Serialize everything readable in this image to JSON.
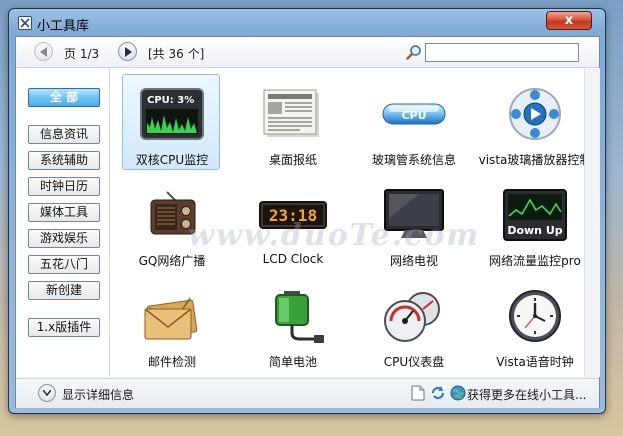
{
  "window": {
    "title": "小工具库",
    "close_label": "x"
  },
  "toolbar": {
    "page_label": "页 1/3",
    "total_label": "[共 36 个]",
    "search_value": ""
  },
  "sidebar": {
    "all_label": "全  部",
    "items": [
      {
        "label": "信息资讯"
      },
      {
        "label": "系统辅助"
      },
      {
        "label": "时钟日历"
      },
      {
        "label": "媒体工具"
      },
      {
        "label": "游戏娱乐"
      },
      {
        "label": "五花八门"
      },
      {
        "label": "新创建"
      }
    ],
    "legacy_label": "1.x版插件"
  },
  "gadgets": [
    {
      "name": "双核CPU监控",
      "icon": "cpu-meter-icon",
      "cpu_text": "CPU: 3%"
    },
    {
      "name": "桌面报纸",
      "icon": "newspaper-icon"
    },
    {
      "name": "玻璃管系统信息",
      "icon": "glass-tube-icon",
      "badge": "CPU"
    },
    {
      "name": "vista玻璃播放器控制",
      "icon": "media-player-icon"
    },
    {
      "name": "GQ网络广播",
      "icon": "radio-icon"
    },
    {
      "name": "LCD Clock",
      "icon": "lcd-clock-icon",
      "lcd_text": "23:18"
    },
    {
      "name": "网络电视",
      "icon": "monitor-icon"
    },
    {
      "name": "网络流量监控pro",
      "icon": "traffic-monitor-icon",
      "monitor_text": "Down Up"
    },
    {
      "name": "邮件检测",
      "icon": "mail-envelope-icon"
    },
    {
      "name": "简单电池",
      "icon": "battery-icon"
    },
    {
      "name": "CPU仪表盘",
      "icon": "gauge-icon"
    },
    {
      "name": "Vista语音时钟",
      "icon": "analog-clock-icon"
    }
  ],
  "watermark": "www.duoTe.com",
  "status": {
    "detail_label": "显示详细信息",
    "more_label": "获得更多在线小工具..."
  },
  "colors": {
    "selected_tile": "#d2e9fc",
    "active_category": "#4faeea",
    "close_button": "#c2361f"
  }
}
